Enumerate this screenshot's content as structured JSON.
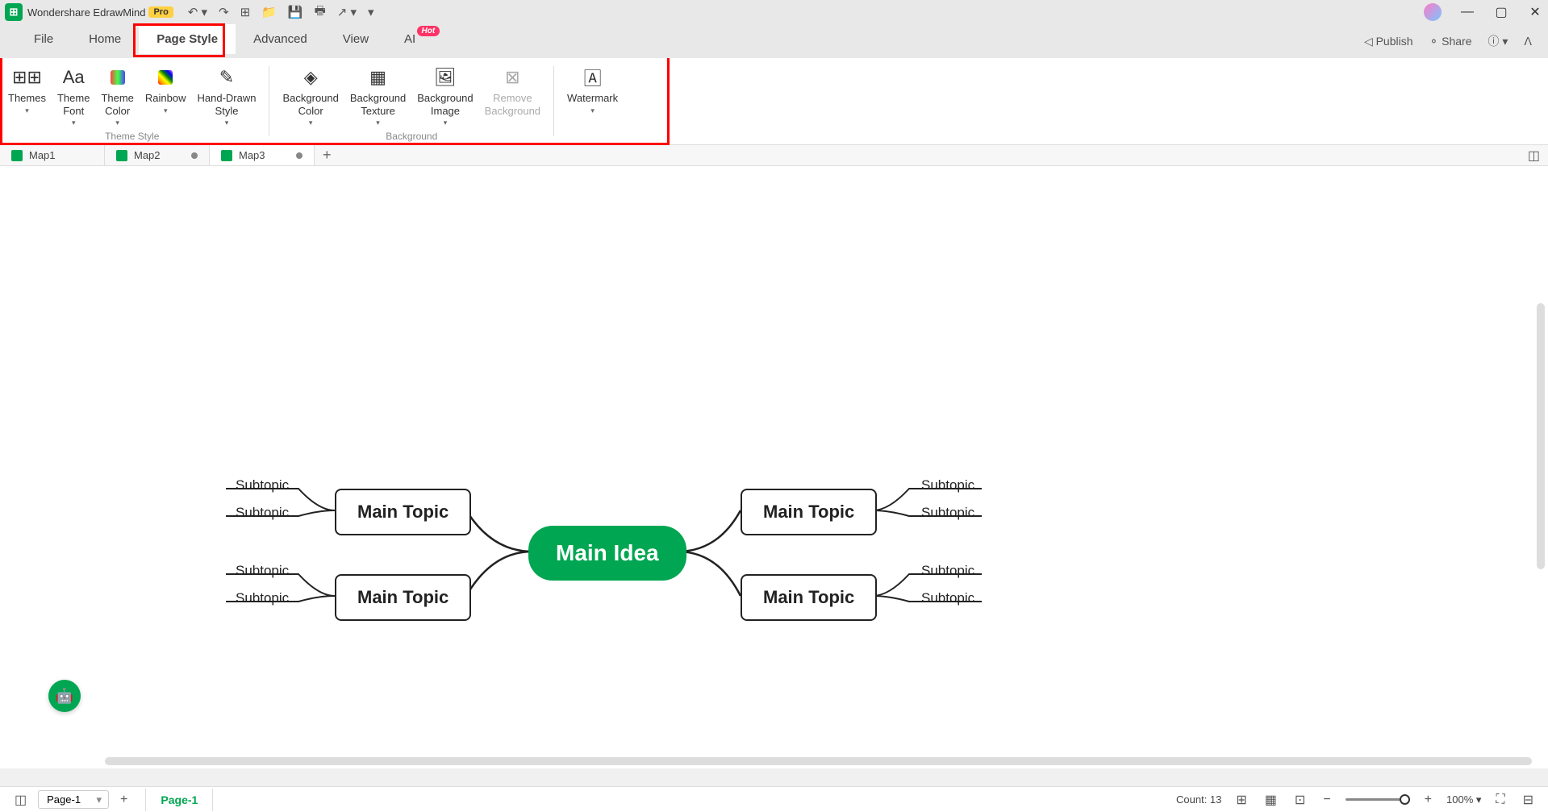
{
  "app": {
    "name": "Wondershare EdrawMind",
    "badge": "Pro"
  },
  "menu": {
    "tabs": [
      "File",
      "Home",
      "Page Style",
      "Advanced",
      "View",
      "AI"
    ],
    "active": "Page Style",
    "hot": "Hot",
    "right": {
      "publish": "Publish",
      "share": "Share"
    }
  },
  "ribbon": {
    "group1_label": "Theme Style",
    "group2_label": "Background",
    "themes": "Themes",
    "theme_font": "Theme\nFont",
    "theme_color": "Theme\nColor",
    "rainbow": "Rainbow",
    "hand_drawn": "Hand-Drawn\nStyle",
    "bg_color": "Background\nColor",
    "bg_texture": "Background\nTexture",
    "bg_image": "Background\nImage",
    "remove_bg": "Remove\nBackground",
    "watermark": "Watermark"
  },
  "doctabs": {
    "tabs": [
      "Map1",
      "Map2",
      "Map3"
    ],
    "active": 2
  },
  "mindmap": {
    "main": "Main Idea",
    "topic": "Main Topic",
    "sub": "Subtopic"
  },
  "status": {
    "page_select": "Page-1",
    "page_tab": "Page-1",
    "count": "Count: 13",
    "zoom": "100%"
  }
}
